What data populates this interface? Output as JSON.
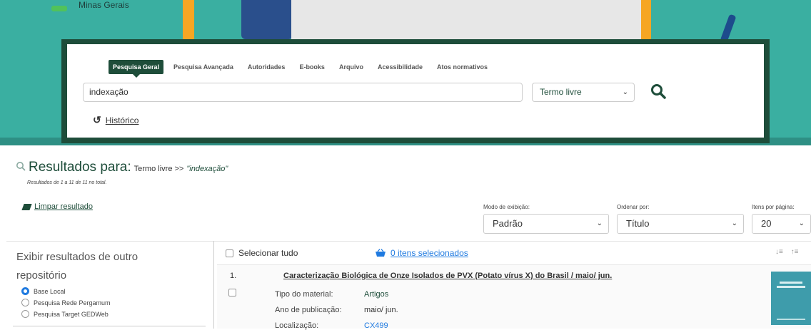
{
  "banner": {
    "brand_text": "Minas Gerais"
  },
  "search": {
    "tabs": [
      "Pesquisa Geral",
      "Pesquisa Avançada",
      "Autoridades",
      "E-books",
      "Arquivo",
      "Acessibilidade",
      "Atos normativos"
    ],
    "active_tab": "Pesquisa Geral",
    "query": "indexação",
    "mode": "Termo livre",
    "historico_label": "Histórico"
  },
  "results": {
    "heading": "Resultados para:",
    "crumb": "Termo livre >>",
    "term": "\"indexação\"",
    "count_text": "Resultados de 1 a 11 de 11 no total.",
    "clear_label": "Limpar resultado",
    "display_mode_label": "Modo de exibição:",
    "display_mode_value": "Padrão",
    "order_label": "Ordenar por:",
    "order_value": "Título",
    "per_page_label": "Itens por página:",
    "per_page_value": "20"
  },
  "sidebar": {
    "title": "Exibir resultados de outro repositório",
    "options": [
      {
        "label": "Base Local",
        "selected": true
      },
      {
        "label": "Pesquisa Rede Pergamum",
        "selected": false
      },
      {
        "label": "Pesquisa Target GEDWeb",
        "selected": false
      }
    ]
  },
  "list": {
    "select_all_label": "Selecionar tudo",
    "selected_items_label": "0 itens selecionados",
    "items": [
      {
        "number": "1.",
        "title": "Caracterização Biológica de Onze Isolados de PVX (Potato vírus X) do Brasil / maio/ jun.",
        "material_label": "Tipo do material:",
        "material_value": "Artigos",
        "year_label": "Ano de publicação:",
        "year_value": "maio/ jun.",
        "location_label": "Localização:",
        "location_value": "CX499"
      }
    ]
  },
  "colors": {
    "brand_green": "#1e4d3a",
    "teal": "#3aafa1",
    "link_blue": "#1f7ae0"
  }
}
